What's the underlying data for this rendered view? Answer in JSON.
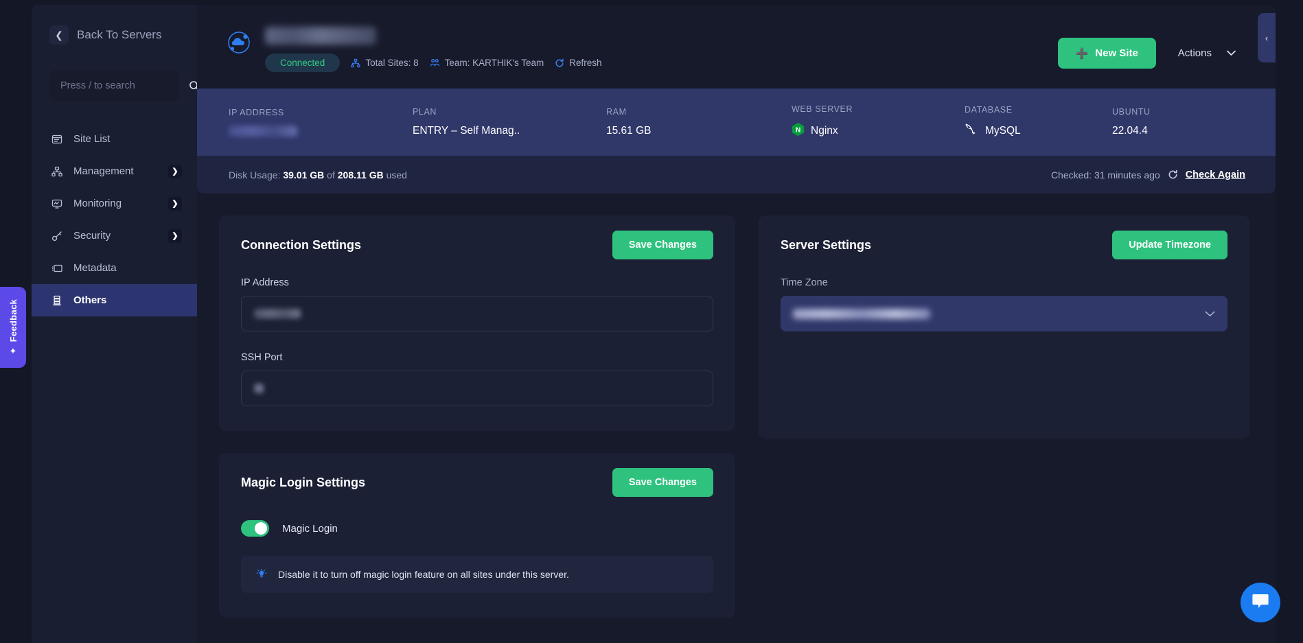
{
  "feedback": {
    "label": "Feedback",
    "icon": "sparkle-icon"
  },
  "sidebar": {
    "back_label": "Back To Servers",
    "search": {
      "placeholder": "Press / to search",
      "value": "",
      "icon": "search-icon"
    },
    "items": [
      {
        "label": "Site List",
        "icon": "site-list-icon",
        "expandable": false,
        "active": false
      },
      {
        "label": "Management",
        "icon": "management-icon",
        "expandable": true,
        "active": false
      },
      {
        "label": "Monitoring",
        "icon": "monitoring-icon",
        "expandable": true,
        "active": false
      },
      {
        "label": "Security",
        "icon": "key-icon",
        "expandable": true,
        "active": false
      },
      {
        "label": "Metadata",
        "icon": "metadata-icon",
        "expandable": false,
        "active": false
      },
      {
        "label": "Others",
        "icon": "server-icon",
        "expandable": false,
        "active": true
      }
    ],
    "chevron_glyph": "❯"
  },
  "header": {
    "logo_icon": "cloud-orbit-icon",
    "server_name": "",
    "status_badge": "Connected",
    "total_sites": "Total Sites: 8",
    "team": "Team: KARTHIK's Team",
    "refresh": "Refresh",
    "new_site_button": "New Site",
    "actions_button": "Actions"
  },
  "info_strip": [
    {
      "key": "IP ADDRESS",
      "value": "",
      "redacted": true,
      "icon": null
    },
    {
      "key": "PLAN",
      "value": "ENTRY – Self Manag..",
      "redacted": false,
      "icon": null
    },
    {
      "key": "RAM",
      "value": "15.61 GB",
      "redacted": false,
      "icon": null
    },
    {
      "key": "WEB SERVER",
      "value": "Nginx",
      "redacted": false,
      "icon": "nginx-icon"
    },
    {
      "key": "DATABASE",
      "value": "MySQL",
      "redacted": false,
      "icon": "mysql-dolphin-icon"
    },
    {
      "key": "UBUNTU",
      "value": "22.04.4",
      "redacted": false,
      "icon": null
    }
  ],
  "disk": {
    "prefix": "Disk Usage: ",
    "used": "39.01 GB",
    "mid": " of ",
    "total": "208.11 GB",
    "suffix": " used",
    "checked": "Checked: 31 minutes ago",
    "check_again": "Check Again",
    "refresh_icon": "refresh-icon"
  },
  "connection_settings": {
    "title": "Connection Settings",
    "save_label": "Save Changes",
    "ip_label": "IP Address",
    "ip_value": "",
    "ssh_label": "SSH Port",
    "ssh_value": ""
  },
  "server_settings": {
    "title": "Server Settings",
    "update_label": "Update Timezone",
    "timezone_label": "Time Zone",
    "timezone_value": "",
    "chevron_glyph": "⌄"
  },
  "magic_login": {
    "title": "Magic Login Settings",
    "save_label": "Save Changes",
    "toggle_label": "Magic Login",
    "toggle_on": true,
    "note": "Disable it to turn off magic login feature on all sites under this server.",
    "note_icon": "lightbulb-icon"
  },
  "right_handle": {
    "icon": "chevron-left-icon",
    "glyph": "‹"
  },
  "chat": {
    "icon": "chat-bubble-icon"
  },
  "colors": {
    "accent_green": "#2ec27e",
    "status_green": "#2fd086",
    "page_bg": "#141726",
    "panel_bg": "#1b2035",
    "strip_bg": "#303769",
    "sidebar_active": "#2d3570",
    "feedback_purple": "#5b4ae8",
    "chat_blue": "#1a7cf0",
    "link_blue": "#3b82f6"
  }
}
